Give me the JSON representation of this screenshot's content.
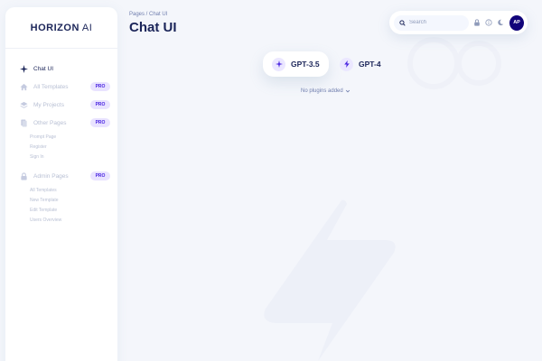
{
  "app": {
    "brand_bold": "HORIZON",
    "brand_thin": "AI"
  },
  "sidebar": {
    "items": [
      {
        "label": "Chat UI",
        "icon": "sparkle-icon",
        "active": true
      },
      {
        "label": "All Templates",
        "icon": "home-icon",
        "badge": "PRO"
      },
      {
        "label": "My Projects",
        "icon": "layers-icon",
        "badge": "PRO"
      },
      {
        "label": "Other Pages",
        "icon": "document-icon",
        "badge": "PRO",
        "children": [
          "Prompt Page",
          "Register",
          "Sign In"
        ]
      },
      {
        "label": "Admin Pages",
        "icon": "lock-icon",
        "badge": "PRO",
        "children": [
          "All Templates",
          "New Template",
          "Edit Template",
          "Users Overview"
        ]
      }
    ]
  },
  "header": {
    "breadcrumb": "Pages  /  Chat UI",
    "title": "Chat UI"
  },
  "topbar": {
    "search_placeholder": "Search",
    "avatar_initials": "AP"
  },
  "models": [
    {
      "label": "GPT-3.5",
      "icon": "sparkle-icon",
      "selected": true
    },
    {
      "label": "GPT-4",
      "icon": "bolt-icon",
      "selected": false
    }
  ],
  "plugins": {
    "label": "No plugins added"
  },
  "colors": {
    "accent": "#4a25e1",
    "navy": "#1b2559",
    "avatar": "#11047a",
    "muted": "#b9c0d4"
  }
}
